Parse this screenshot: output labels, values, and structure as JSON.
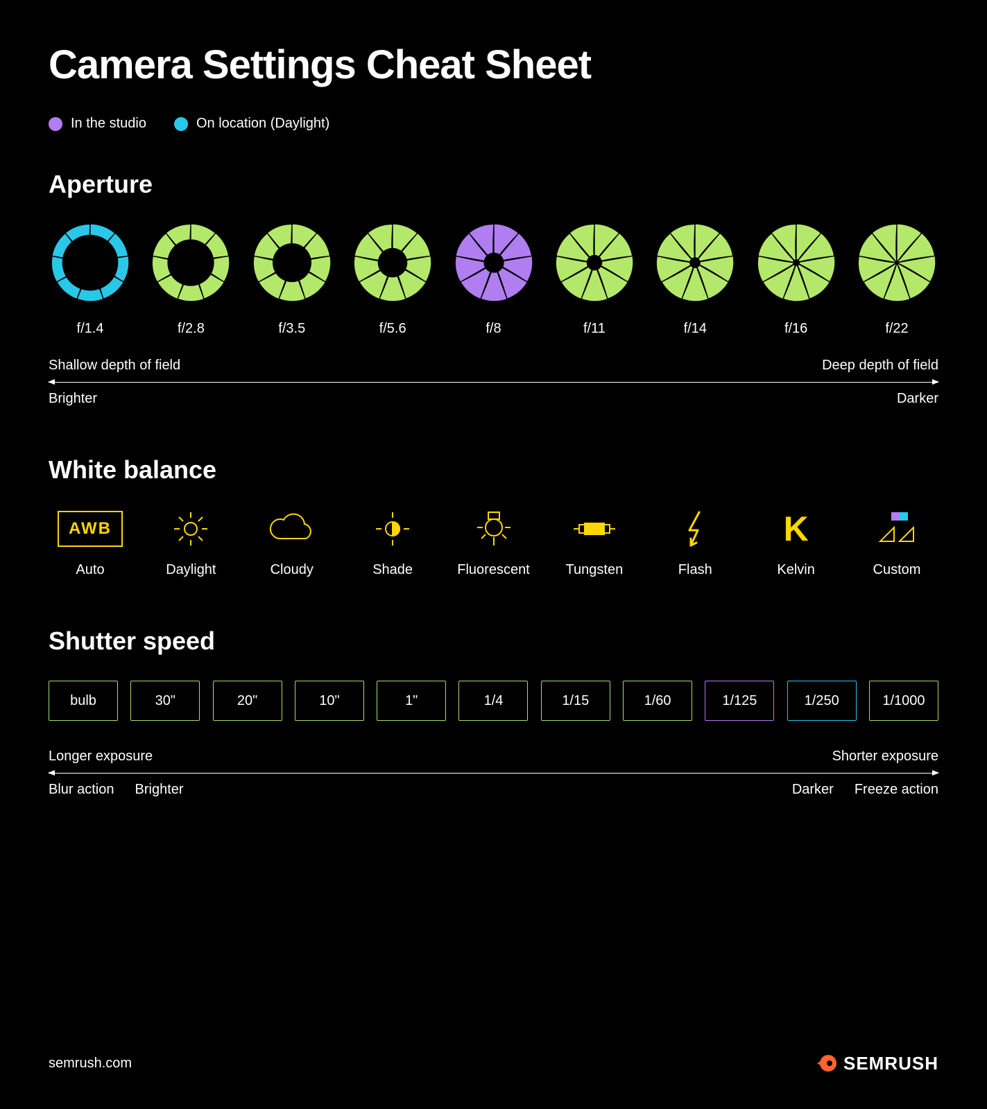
{
  "title": "Camera Settings Cheat Sheet",
  "legend": {
    "studio": "In the studio",
    "location": "On location (Daylight)"
  },
  "aperture": {
    "heading": "Aperture",
    "items": [
      "f/1.4",
      "f/2.8",
      "f/3.5",
      "f/5.6",
      "f/8",
      "f/11",
      "f/14",
      "f/16",
      "f/22"
    ],
    "left_top": "Shallow depth of field",
    "right_top": "Deep depth of field",
    "left_bottom": "Brighter",
    "right_bottom": "Darker"
  },
  "white_balance": {
    "heading": "White balance",
    "items": [
      "Auto",
      "Daylight",
      "Cloudy",
      "Shade",
      "Fluorescent",
      "Tungsten",
      "Flash",
      "Kelvin",
      "Custom"
    ],
    "awb_label": "AWB"
  },
  "shutter": {
    "heading": "Shutter speed",
    "items": [
      "bulb",
      "30\"",
      "20\"",
      "10\"",
      "1\"",
      "1/4",
      "1/15",
      "1/60",
      "1/125",
      "1/250",
      "1/1000"
    ],
    "left_top": "Longer exposure",
    "right_top": "Shorter exposure",
    "left_bottom_a": "Blur action",
    "left_bottom_b": "Brighter",
    "right_bottom_a": "Darker",
    "right_bottom_b": "Freeze action"
  },
  "footer": {
    "site": "semrush.com",
    "brand": "SEMRUSH"
  },
  "colors": {
    "green": "#B4E86A",
    "purple": "#B07EF0",
    "cyan": "#2AC8E8",
    "yellow": "#FFD600"
  },
  "chart_data": {
    "type": "table",
    "title": "Camera Settings Cheat Sheet",
    "legend": [
      {
        "name": "In the studio",
        "color": "purple"
      },
      {
        "name": "On location (Daylight)",
        "color": "cyan"
      }
    ],
    "aperture": {
      "stops": [
        "f/1.4",
        "f/2.8",
        "f/3.5",
        "f/5.6",
        "f/8",
        "f/11",
        "f/14",
        "f/16",
        "f/22"
      ],
      "highlights": {
        "f/1.4": "cyan",
        "f/8": "purple"
      },
      "scale_left": [
        "Shallow depth of field",
        "Brighter"
      ],
      "scale_right": [
        "Deep depth of field",
        "Darker"
      ]
    },
    "white_balance": {
      "modes": [
        "Auto",
        "Daylight",
        "Cloudy",
        "Shade",
        "Fluorescent",
        "Tungsten",
        "Flash",
        "Kelvin",
        "Custom"
      ]
    },
    "shutter_speed": {
      "values": [
        "bulb",
        "30\"",
        "20\"",
        "10\"",
        "1\"",
        "1/4",
        "1/15",
        "1/60",
        "1/125",
        "1/250",
        "1/1000"
      ],
      "highlights": {
        "1/125": "purple",
        "1/250": "cyan"
      },
      "scale_left": [
        "Longer exposure",
        "Blur action",
        "Brighter"
      ],
      "scale_right": [
        "Shorter exposure",
        "Darker",
        "Freeze action"
      ]
    }
  }
}
